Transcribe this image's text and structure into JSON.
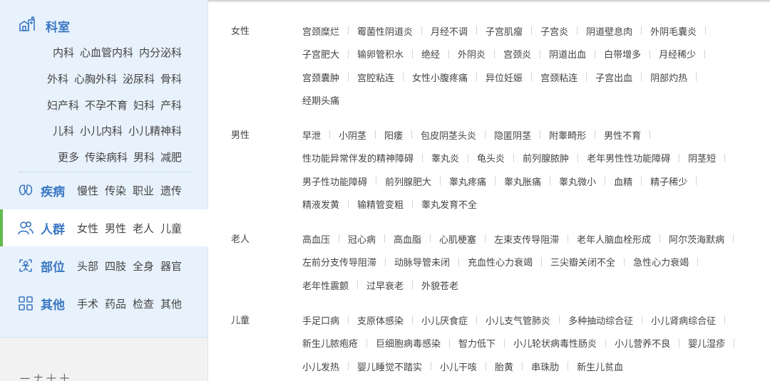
{
  "sidebar": {
    "departments": {
      "title": "科室",
      "rows": [
        [
          "内科",
          "心血管内科",
          "内分泌科"
        ],
        [
          "外科",
          "心胸外科",
          "泌尿科",
          "骨科"
        ],
        [
          "妇产科",
          "不孕不育",
          "妇科",
          "产科"
        ],
        [
          "儿科",
          "小儿内科",
          "小儿精神科"
        ],
        [
          "更多",
          "传染病科",
          "男科",
          "减肥"
        ]
      ]
    },
    "categories": [
      {
        "title": "疾病",
        "items": [
          "慢性",
          "传染",
          "职业",
          "遗传"
        ],
        "icon": "kidney-icon"
      },
      {
        "title": "人群",
        "items": [
          "女性",
          "男性",
          "老人",
          "儿童"
        ],
        "icon": "people-icon"
      },
      {
        "title": "部位",
        "items": [
          "头部",
          "四肢",
          "全身",
          "器官"
        ],
        "icon": "body-icon"
      },
      {
        "title": "其他",
        "items": [
          "手术",
          "药品",
          "检查",
          "其他"
        ],
        "icon": "grid-icon"
      }
    ],
    "footer": "一 ナ 十 十"
  },
  "groups": [
    {
      "label": "女性",
      "rows": [
        [
          "宫颈糜烂",
          "霉菌性阴道炎",
          "月经不调",
          "子宫肌瘤",
          "子宫炎",
          "阴道壁息肉",
          "外阴毛囊炎"
        ],
        [
          "子宫肥大",
          "输卵管积水",
          "绝经",
          "外阴炎",
          "宫颈炎",
          "阴道出血",
          "白带增多",
          "月经稀少"
        ],
        [
          "宫颈囊肿",
          "宫腔粘连",
          "女性小腹疼痛",
          "异位妊娠",
          "宫颈粘连",
          "子宫出血",
          "阴部灼热"
        ],
        [
          "经期头痛"
        ]
      ]
    },
    {
      "label": "男性",
      "rows": [
        [
          "早泄",
          "小阴茎",
          "阳痿",
          "包皮阴茎头炎",
          "隐匿阴茎",
          "附睾畸形",
          "男性不育"
        ],
        [
          "性功能异常伴发的精神障碍",
          "睾丸炎",
          "龟头炎",
          "前列腺脓肿",
          "老年男性性功能障碍",
          "阴茎短"
        ],
        [
          "男子性功能障碍",
          "前列腺肥大",
          "睾丸疼痛",
          "睾丸胀痛",
          "睾丸微小",
          "血精",
          "精子稀少"
        ],
        [
          "精液发黄",
          "输精管变粗",
          "睾丸发育不全"
        ]
      ]
    },
    {
      "label": "老人",
      "rows": [
        [
          "高血压",
          "冠心病",
          "高血脂",
          "心肌梗塞",
          "左束支传导阻滞",
          "老年人脑血栓形成",
          "阿尔茨海默病"
        ],
        [
          "左前分支传导阻滞",
          "动脉导管未闭",
          "充血性心力衰竭",
          "三尖瓣关闭不全",
          "急性心力衰竭"
        ],
        [
          "老年性震颤",
          "过早衰老",
          "外貌苍老"
        ]
      ]
    },
    {
      "label": "儿童",
      "rows": [
        [
          "手足口病",
          "支原体感染",
          "小儿厌食症",
          "小儿支气管肺炎",
          "多种抽动综合征",
          "小儿肾病综合征"
        ],
        [
          "新生儿脓疱疮",
          "巨细胞病毒感染",
          "智力低下",
          "小儿轮状病毒性肠炎",
          "小儿营养不良",
          "婴儿湿疹"
        ],
        [
          "小儿发热",
          "婴儿睡觉不踏实",
          "小儿干咳",
          "胎黄",
          "串珠肋",
          "新生儿贫血"
        ]
      ]
    }
  ],
  "colors": {
    "accent": "#3a77c2",
    "active": "#62b94f",
    "panel": "#e8f2fc"
  }
}
